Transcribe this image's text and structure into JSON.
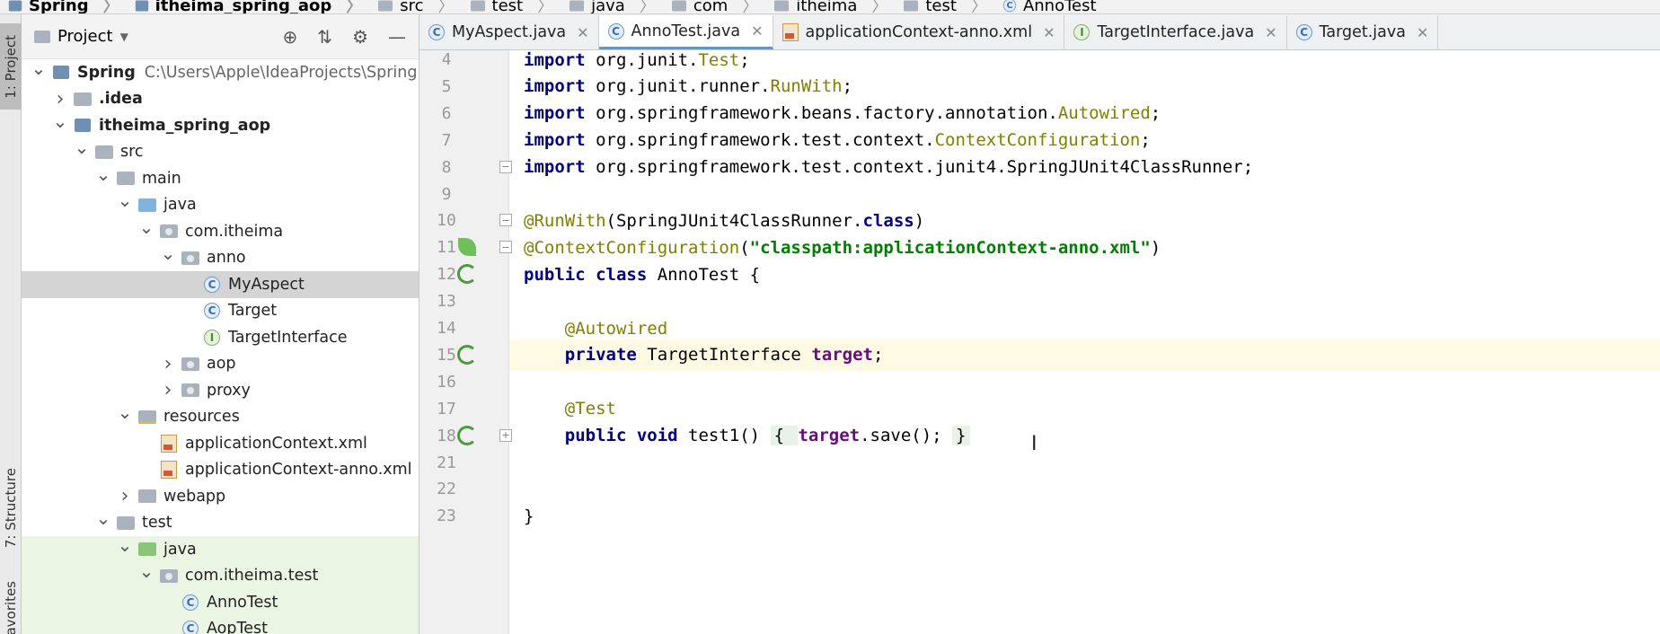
{
  "breadcrumb": [
    "Spring",
    "itheima_spring_aop",
    "src",
    "test",
    "java",
    "com",
    "itheima",
    "test",
    "AnnoTest"
  ],
  "side_tabs": {
    "project": "1: Project",
    "structure": "7: Structure",
    "favorites": "Favorites"
  },
  "project_panel": {
    "title": "Project",
    "tree": [
      {
        "label": "Spring",
        "sub": "C:\\Users\\Apple\\IdeaProjects\\Spring",
        "icon": "module-icon",
        "arrow": "down"
      },
      {
        "label": ".idea",
        "icon": "folder-icon",
        "arrow": "right"
      },
      {
        "label": "itheima_spring_aop",
        "icon": "module-icon",
        "arrow": "down"
      },
      {
        "label": "src",
        "icon": "folder-icon",
        "arrow": "down"
      },
      {
        "label": "main",
        "icon": "folder-icon",
        "arrow": "down"
      },
      {
        "label": "java",
        "icon": "source-folder-icon",
        "arrow": "down"
      },
      {
        "label": "com.itheima",
        "icon": "package-icon",
        "arrow": "down"
      },
      {
        "label": "anno",
        "icon": "package-icon",
        "arrow": "down"
      },
      {
        "label": "MyAspect",
        "icon": "class-icon",
        "arrow": "none",
        "selected": true
      },
      {
        "label": "Target",
        "icon": "class-icon",
        "arrow": "none"
      },
      {
        "label": "TargetInterface",
        "icon": "interface-icon",
        "arrow": "none"
      },
      {
        "label": "aop",
        "icon": "package-icon",
        "arrow": "right"
      },
      {
        "label": "proxy",
        "icon": "package-icon",
        "arrow": "right"
      },
      {
        "label": "resources",
        "icon": "resources-folder-icon",
        "arrow": "down"
      },
      {
        "label": "applicationContext.xml",
        "icon": "xml-file-icon",
        "arrow": "none"
      },
      {
        "label": "applicationContext-anno.xml",
        "icon": "xml-file-icon",
        "arrow": "none"
      },
      {
        "label": "webapp",
        "icon": "folder-icon",
        "arrow": "right"
      },
      {
        "label": "test",
        "icon": "folder-icon",
        "arrow": "down"
      },
      {
        "label": "java",
        "icon": "test-folder-icon",
        "arrow": "down",
        "green": true
      },
      {
        "label": "com.itheima.test",
        "icon": "package-icon",
        "arrow": "down",
        "green": true
      },
      {
        "label": "AnnoTest",
        "icon": "test-class-icon",
        "arrow": "none",
        "green": true
      },
      {
        "label": "AopTest",
        "icon": "test-class-icon",
        "arrow": "none",
        "green": true
      }
    ]
  },
  "tabs": [
    {
      "label": "MyAspect.java",
      "icon": "class-icon",
      "active": false
    },
    {
      "label": "AnnoTest.java",
      "icon": "test-class-icon",
      "active": true
    },
    {
      "label": "applicationContext-anno.xml",
      "icon": "xml-file-icon",
      "active": false
    },
    {
      "label": "TargetInterface.java",
      "icon": "interface-icon",
      "active": false
    },
    {
      "label": "Target.java",
      "icon": "class-icon",
      "active": false
    }
  ],
  "code": {
    "lines": [
      {
        "num": "4",
        "segments": [
          [
            "kw",
            "import"
          ],
          [
            "plain",
            " org.junit."
          ],
          [
            "cls",
            "Test"
          ],
          [
            "plain",
            ";"
          ]
        ]
      },
      {
        "num": "5",
        "segments": [
          [
            "kw",
            "import"
          ],
          [
            "plain",
            " org.junit.runner."
          ],
          [
            "cls",
            "RunWith"
          ],
          [
            "plain",
            ";"
          ]
        ]
      },
      {
        "num": "6",
        "segments": [
          [
            "kw",
            "import"
          ],
          [
            "plain",
            " org.springframework.beans.factory.annotation."
          ],
          [
            "cls",
            "Autowired"
          ],
          [
            "plain",
            ";"
          ]
        ]
      },
      {
        "num": "7",
        "segments": [
          [
            "kw",
            "import"
          ],
          [
            "plain",
            " org.springframework.test.context."
          ],
          [
            "cls",
            "ContextConfiguration"
          ],
          [
            "plain",
            ";"
          ]
        ]
      },
      {
        "num": "8",
        "segments": [
          [
            "kw",
            "import"
          ],
          [
            "plain",
            " org.springframework.test.context.junit4.SpringJUnit4ClassRunner;"
          ]
        ]
      },
      {
        "num": "9",
        "segments": []
      },
      {
        "num": "10",
        "segments": [
          [
            "ann",
            "@RunWith"
          ],
          [
            "plain",
            "(SpringJUnit4ClassRunner."
          ],
          [
            "kw",
            "class"
          ],
          [
            "plain",
            ")"
          ]
        ]
      },
      {
        "num": "11",
        "segments": [
          [
            "ann",
            "@ContextConfiguration"
          ],
          [
            "plain",
            "("
          ],
          [
            "str",
            "\"classpath:applicationContext-anno.xml\""
          ],
          [
            "plain",
            ")"
          ]
        ]
      },
      {
        "num": "12",
        "segments": [
          [
            "kw",
            "public class"
          ],
          [
            "plain",
            " AnnoTest {"
          ]
        ]
      },
      {
        "num": "13",
        "segments": []
      },
      {
        "num": "14",
        "segments": [
          [
            "plain",
            "    "
          ],
          [
            "ann",
            "@Autowired"
          ]
        ]
      },
      {
        "num": "15",
        "segments": [
          [
            "plain",
            "    "
          ],
          [
            "kw",
            "private"
          ],
          [
            "plain",
            " TargetInterface "
          ],
          [
            "fld",
            "target"
          ],
          [
            "plain",
            ";"
          ]
        ]
      },
      {
        "num": "16",
        "segments": []
      },
      {
        "num": "17",
        "segments": [
          [
            "plain",
            "    "
          ],
          [
            "ann",
            "@Test"
          ]
        ]
      },
      {
        "num": "18",
        "segments": [
          [
            "plain",
            "    "
          ],
          [
            "kw",
            "public void"
          ],
          [
            "plain",
            " test1() "
          ],
          [
            "box",
            "{ "
          ],
          [
            "fld",
            "target"
          ],
          [
            "plain",
            ".save(); "
          ],
          [
            "box",
            "}"
          ]
        ]
      },
      {
        "num": "21",
        "segments": []
      },
      {
        "num": "22",
        "segments": []
      },
      {
        "num": "23",
        "segments": [
          [
            "plain",
            "}"
          ]
        ]
      }
    ],
    "current_line": "15",
    "run_gutter_lines": [
      "12",
      "15",
      "18"
    ],
    "bean_gutter_lines": [
      "11"
    ],
    "fold_lines": [
      "8",
      "10",
      "11",
      "18"
    ]
  }
}
